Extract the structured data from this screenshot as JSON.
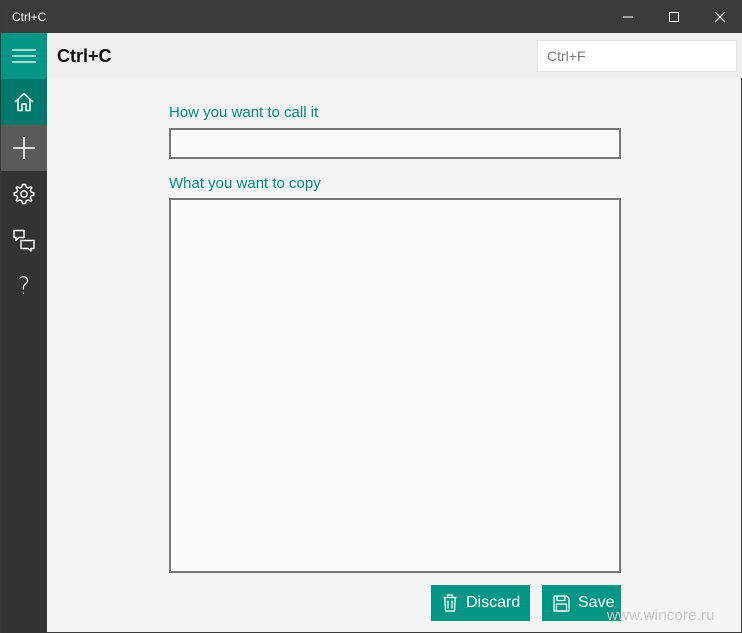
{
  "window": {
    "title": "Ctrl+C"
  },
  "header": {
    "app_title": "Ctrl+C",
    "search_placeholder": "Ctrl+F"
  },
  "nav": {
    "items": [
      {
        "icon": "hamburger-icon"
      },
      {
        "icon": "home-icon"
      },
      {
        "icon": "plus-icon"
      },
      {
        "icon": "gear-icon"
      },
      {
        "icon": "feedback-icon"
      },
      {
        "icon": "question-icon",
        "glyph": "?"
      }
    ]
  },
  "form": {
    "name_label": "How you want to call it",
    "name_value": "",
    "copy_label": "What you want to copy",
    "copy_value": ""
  },
  "actions": {
    "discard_label": "Discard",
    "save_label": "Save"
  },
  "watermark": "www.wincore.ru",
  "colors": {
    "accent": "#009686",
    "accent_dark": "#00786c",
    "label": "#00897b",
    "titlebar": "#3b3b3b",
    "nav": "#333333"
  }
}
